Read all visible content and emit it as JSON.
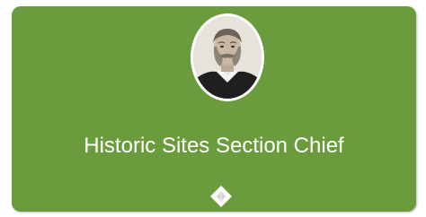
{
  "node": {
    "title": "Historic Sites Section Chief"
  },
  "colors": {
    "card_fill": "#6a9c3d",
    "title_text": "#ffffff",
    "avatar_border": "#ffffff",
    "expander_fill": "#ffffff",
    "expander_inner": "#e4e4e4"
  },
  "icons": {
    "avatar": "portrait-photo",
    "expander": "expand-collapse-diamond-icon"
  }
}
